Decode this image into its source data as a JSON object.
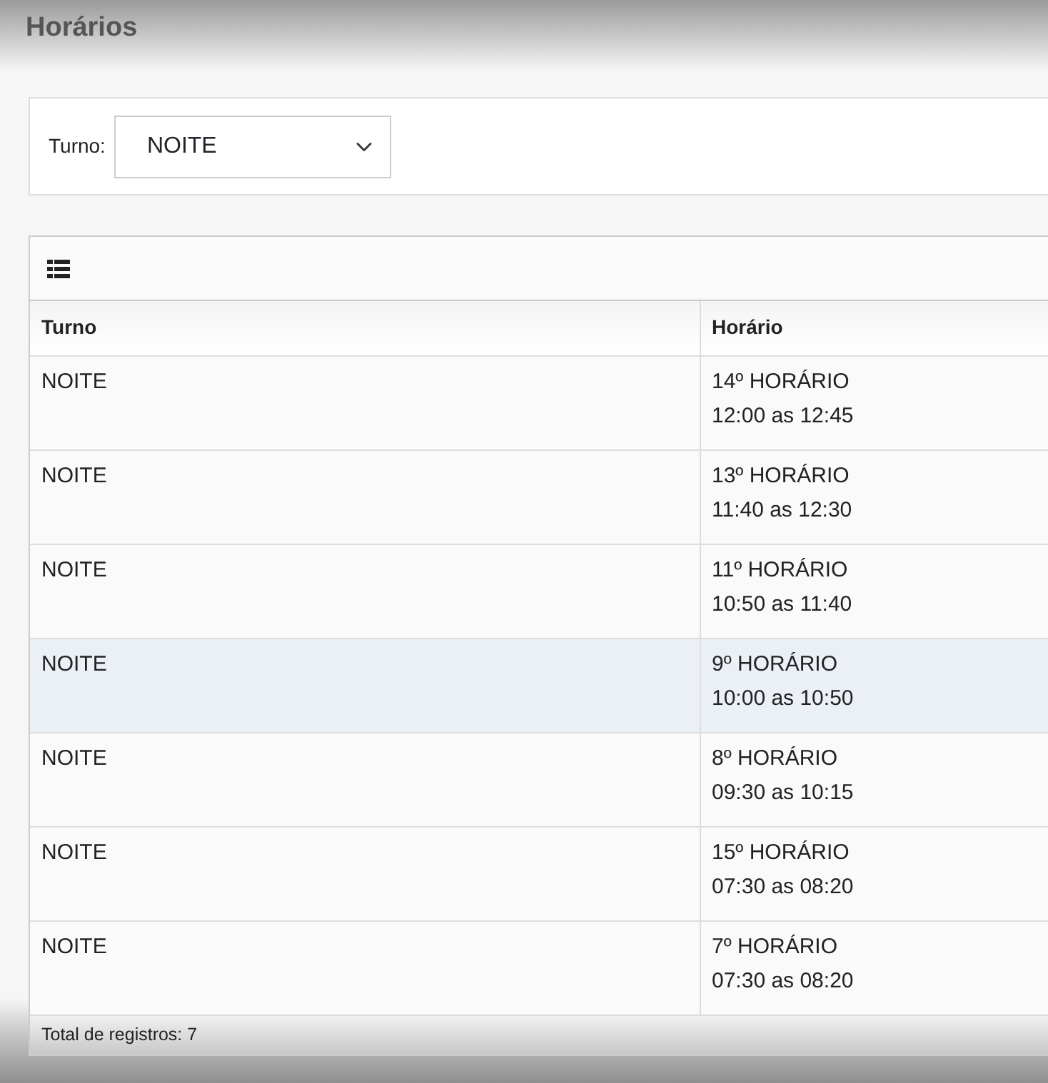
{
  "page": {
    "title": "Horários"
  },
  "filter": {
    "label": "Turno:",
    "value": "NOITE"
  },
  "table": {
    "columns": [
      "Turno",
      "Horário"
    ],
    "rows": [
      {
        "turno": "NOITE",
        "slot": "14º HORÁRIO",
        "time": "12:00 as 12:45",
        "selected": false
      },
      {
        "turno": "NOITE",
        "slot": "13º HORÁRIO",
        "time": "11:40 as 12:30",
        "selected": false
      },
      {
        "turno": "NOITE",
        "slot": "11º HORÁRIO",
        "time": "10:50 as 11:40",
        "selected": false
      },
      {
        "turno": "NOITE",
        "slot": "9º HORÁRIO",
        "time": "10:00 as 10:50",
        "selected": true
      },
      {
        "turno": "NOITE",
        "slot": "8º HORÁRIO",
        "time": "09:30 as 10:15",
        "selected": false
      },
      {
        "turno": "NOITE",
        "slot": "15º HORÁRIO",
        "time": "07:30 as 08:20",
        "selected": false
      },
      {
        "turno": "NOITE",
        "slot": "7º HORÁRIO",
        "time": "07:30 as 08:20",
        "selected": false
      }
    ]
  },
  "footer": "Total de registros: 7"
}
